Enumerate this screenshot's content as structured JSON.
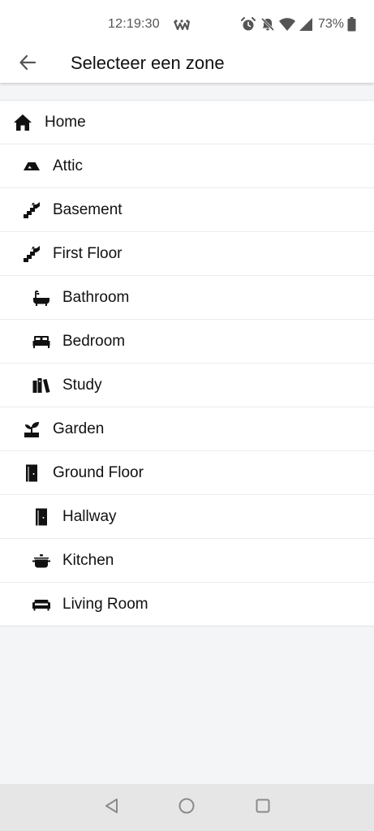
{
  "status_bar": {
    "time": "12:19:30",
    "battery_percent": "73%",
    "icons": [
      "app-notification-icon",
      "alarm-icon",
      "notifications-off-icon",
      "wifi-icon",
      "signal-icon",
      "battery-icon"
    ]
  },
  "app_bar": {
    "title": "Selecteer een zone",
    "back_icon": "arrow-back-icon"
  },
  "zones": [
    {
      "label": "Home",
      "icon": "home-icon",
      "level": 0
    },
    {
      "label": "Attic",
      "icon": "attic-icon",
      "level": 1
    },
    {
      "label": "Basement",
      "icon": "stairs-icon",
      "level": 1
    },
    {
      "label": "First Floor",
      "icon": "stairs-icon",
      "level": 1
    },
    {
      "label": "Bathroom",
      "icon": "bathtub-icon",
      "level": 2
    },
    {
      "label": "Bedroom",
      "icon": "bed-icon",
      "level": 2
    },
    {
      "label": "Study",
      "icon": "books-icon",
      "level": 2
    },
    {
      "label": "Garden",
      "icon": "plant-icon",
      "level": 1
    },
    {
      "label": "Ground Floor",
      "icon": "door-icon",
      "level": 1
    },
    {
      "label": "Hallway",
      "icon": "door-icon",
      "level": 2
    },
    {
      "label": "Kitchen",
      "icon": "cooking-pot-icon",
      "level": 2
    },
    {
      "label": "Living Room",
      "icon": "sofa-icon",
      "level": 2
    }
  ],
  "nav_bar": {
    "buttons": [
      "back-triangle-icon",
      "home-circle-icon",
      "recents-square-icon"
    ]
  }
}
